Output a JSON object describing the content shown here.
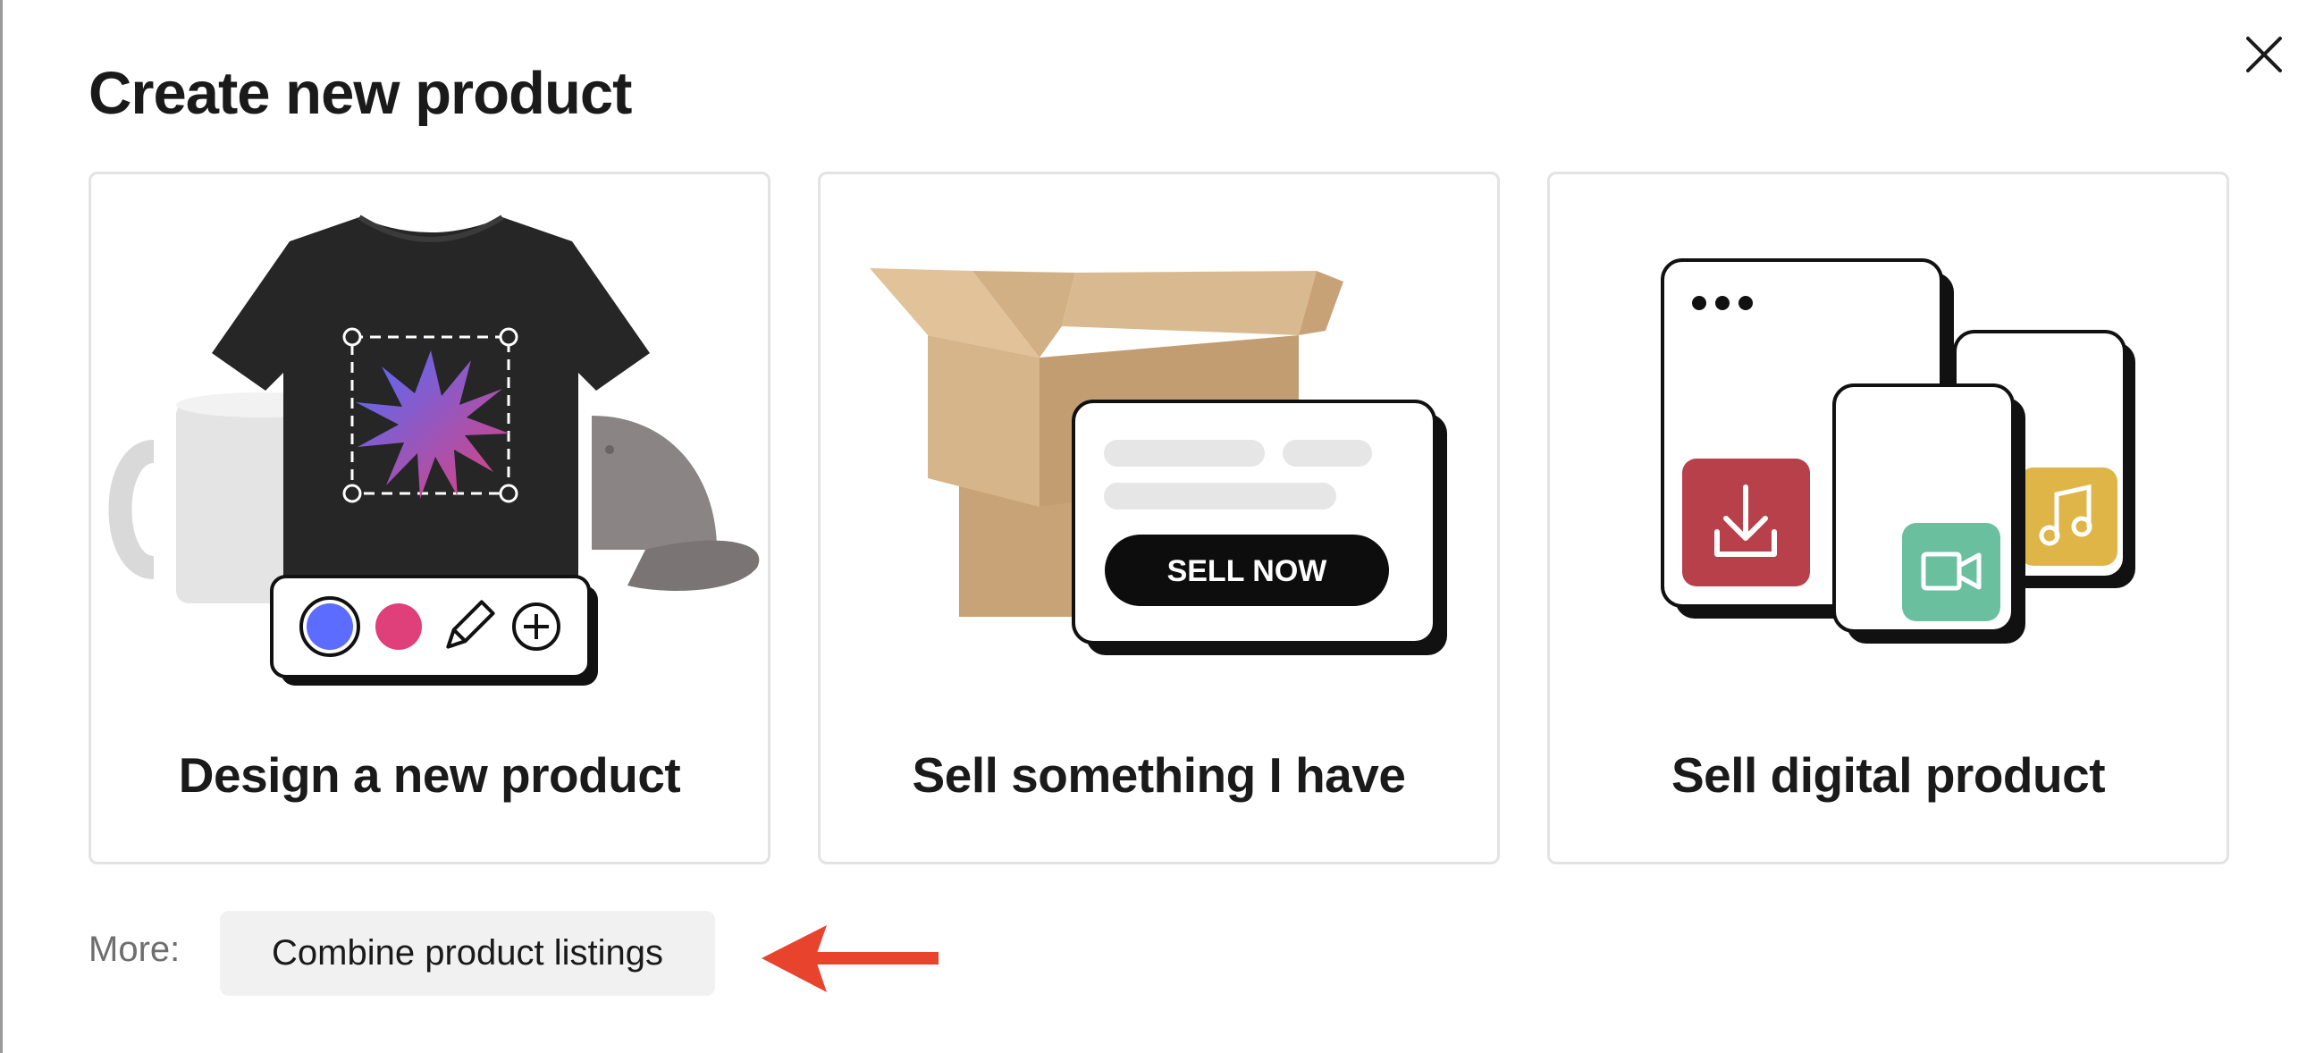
{
  "dialog": {
    "title": "Create new product",
    "close_icon": "close-icon"
  },
  "cards": [
    {
      "label": "Design a new product",
      "illustration": "apparel-mug-cap-illustration",
      "toolbar_icons": [
        "color-swatch-blue",
        "color-swatch-pink",
        "pencil-icon",
        "plus-circle-icon"
      ],
      "swatch_colors": [
        "#5b6cff",
        "#e0407a"
      ]
    },
    {
      "label": "Sell something I have",
      "illustration": "cardboard-box-illustration",
      "sell_button_label": "SELL NOW"
    },
    {
      "label": "Sell digital product",
      "illustration": "digital-files-illustration",
      "tile_icons": [
        "download-icon",
        "video-camera-icon",
        "music-note-icon"
      ],
      "tile_colors": [
        "#b8404a",
        "#6abf9f",
        "#e0b548"
      ]
    }
  ],
  "more": {
    "label": "More:",
    "combine_button": "Combine product listings"
  },
  "annotation": {
    "arrow_color": "#e8432d",
    "arrow_icon": "left-arrow-icon"
  }
}
